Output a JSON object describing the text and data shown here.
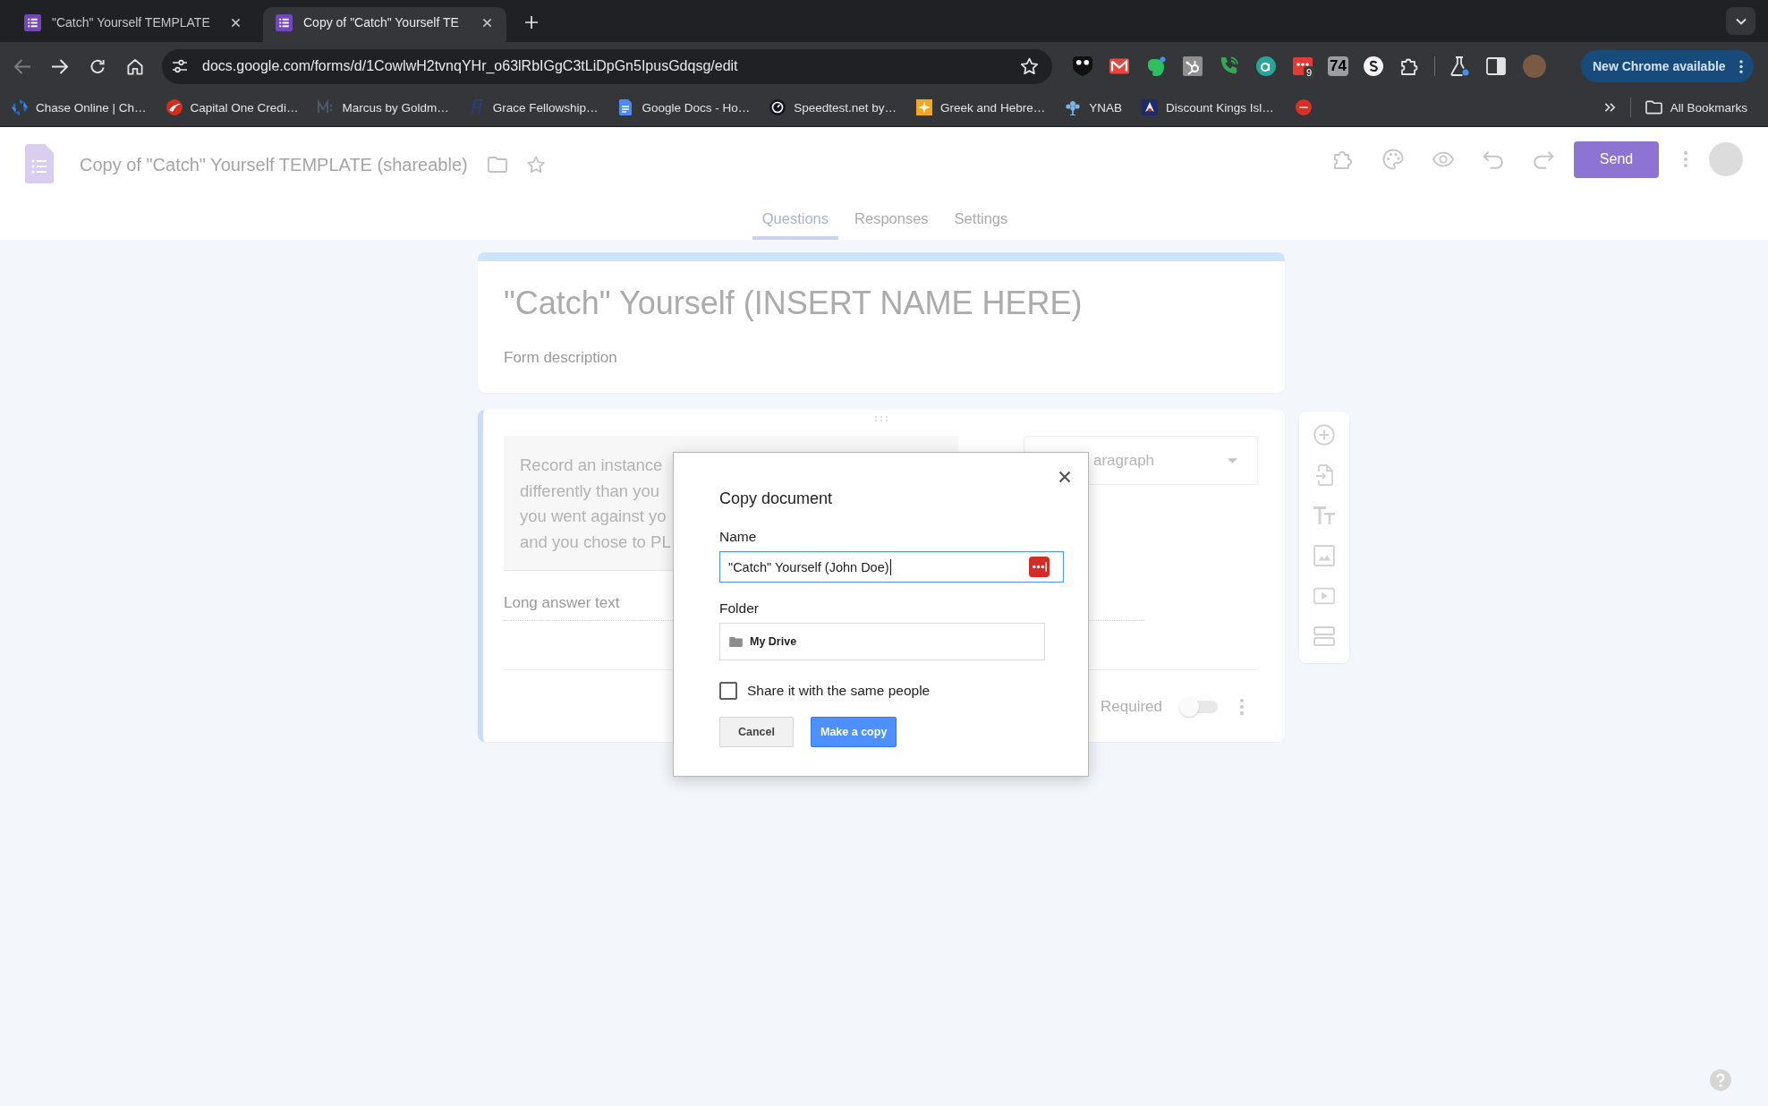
{
  "browser": {
    "tabs": [
      {
        "title": "\"Catch\" Yourself TEMPLATE",
        "selected": false
      },
      {
        "title": "Copy of \"Catch\" Yourself TE",
        "selected": true
      }
    ],
    "address_bar": {
      "value": "docs.google.com/forms/d/1CowlwH2tvnqYHr_o63lRbIGgC3tLiDpGn5IpusGdqsg/edit"
    },
    "extensions": {
      "badge": "9",
      "counter": "74"
    },
    "update_button": "New Chrome available",
    "bookmarks": [
      {
        "label": "Chase Online | Ch…"
      },
      {
        "label": "Capital One Credi…"
      },
      {
        "label": "Marcus by Goldm…"
      },
      {
        "label": "Grace Fellowship…"
      },
      {
        "label": "Google Docs - Ho…"
      },
      {
        "label": "Speedtest.net by…"
      },
      {
        "label": "Greek and Hebre…"
      },
      {
        "label": "YNAB"
      },
      {
        "label": "Discount Kings Isl…"
      }
    ],
    "all_bookmarks": "All Bookmarks"
  },
  "forms_header": {
    "title": "Copy of \"Catch\" Yourself TEMPLATE (shareable)",
    "send_button": "Send",
    "tabs": [
      {
        "label": "Questions",
        "selected": true
      },
      {
        "label": "Responses",
        "selected": false
      },
      {
        "label": "Settings",
        "selected": false
      }
    ]
  },
  "form": {
    "title": "\"Catch\" Yourself (INSERT NAME HERE)",
    "description": {
      "placeholder": "Form description"
    }
  },
  "question": {
    "text_lines": [
      "Record an instance",
      "differently than you",
      "you went against yo",
      "and you chose to PL"
    ],
    "type": "aragraph",
    "answer": {
      "placeholder": "Long answer text"
    },
    "required_label": "Required",
    "required": false
  },
  "dialog": {
    "title": "Copy document",
    "name": {
      "label": "Name",
      "value": "\"Catch\" Yourself (John Doe)"
    },
    "folder": {
      "label": "Folder",
      "value": "My Drive"
    },
    "share": {
      "label": "Share it with the same people",
      "checked": false
    },
    "buttons": [
      {
        "label": "Cancel",
        "kind": "secondary"
      },
      {
        "label": "Make a copy",
        "kind": "primary"
      }
    ]
  }
}
